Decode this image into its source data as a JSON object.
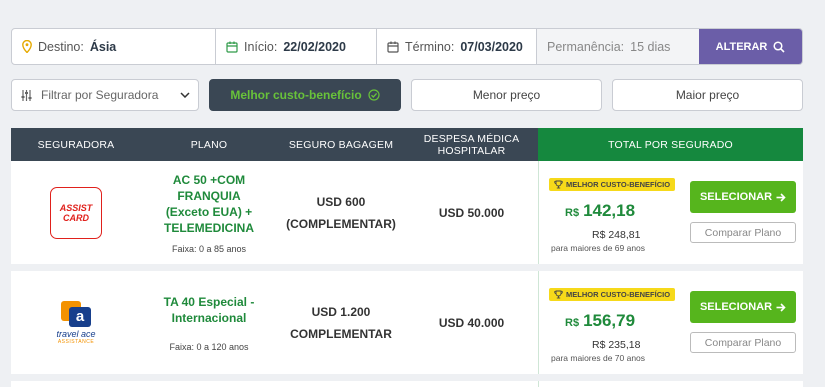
{
  "search": {
    "destination_label": "Destino:",
    "destination_value": "Ásia",
    "start_label": "Início:",
    "start_value": "22/02/2020",
    "end_label": "Término:",
    "end_value": "07/03/2020",
    "stay_label": "Permanência:",
    "stay_value": "15 dias",
    "alter_button": "ALTERAR"
  },
  "filters": {
    "insurer_select": "Filtrar por Seguradora",
    "best_value": "Melhor custo-benefício",
    "lowest_price": "Menor preço",
    "highest_price": "Maior preço"
  },
  "table": {
    "headers": {
      "insurer": "SEGURADORA",
      "plan": "PLANO",
      "baggage": "SEGURO BAGAGEM",
      "medical_1": "DESPESA MÉDICA",
      "medical_2": "HOSPITALAR",
      "total": "TOTAL POR SEGURADO"
    },
    "rows": [
      {
        "insurer_logo_1": "ASSIST",
        "insurer_logo_2": "CARD",
        "plan_lines": [
          "AC 50 +COM FRANQUIA",
          "(Exceto EUA) +",
          "TELEMEDICINA"
        ],
        "age_range": "Faixa: 0 a 85 anos",
        "baggage_lines": [
          "USD 600",
          "(COMPLEMENTAR)"
        ],
        "medical": "USD 50.000",
        "badge": "MELHOR CUSTO-BENEFÍCIO",
        "currency": "R$",
        "price": "142,18",
        "old_price": "R$ 248,81",
        "note": "para maiores de 69 anos",
        "select_button": "SELECIONAR",
        "compare_button": "Comparar Plano"
      },
      {
        "insurer_logo_mark": "a",
        "insurer_logo_1": "travel ace",
        "insurer_logo_2": "ASSISTANCE",
        "plan_lines": [
          "TA 40 Especial -",
          "Internacional"
        ],
        "age_range": "Faixa: 0 a 120 anos",
        "baggage_lines": [
          "USD 1.200",
          "COMPLEMENTAR"
        ],
        "medical": "USD 40.000",
        "badge": "MELHOR CUSTO-BENEFÍCIO",
        "currency": "R$",
        "price": "156,79",
        "old_price": "R$ 235,18",
        "note": "para maiores de 70 anos",
        "select_button": "SELECIONAR",
        "compare_button": "Comparar Plano"
      }
    ]
  },
  "colors": {
    "header_dark": "#3a4754",
    "header_green": "#15883e",
    "accent_purple": "#6b5ea8",
    "button_green": "#56b51d",
    "badge_yellow": "#f6d91a",
    "price_green": "#1f8a3b"
  },
  "icons": [
    "map-pin-icon",
    "calendar-icon",
    "search-icon",
    "filter-sliders-icon",
    "chevron-down-icon",
    "check-circle-icon",
    "trophy-icon",
    "arrow-right-icon"
  ]
}
